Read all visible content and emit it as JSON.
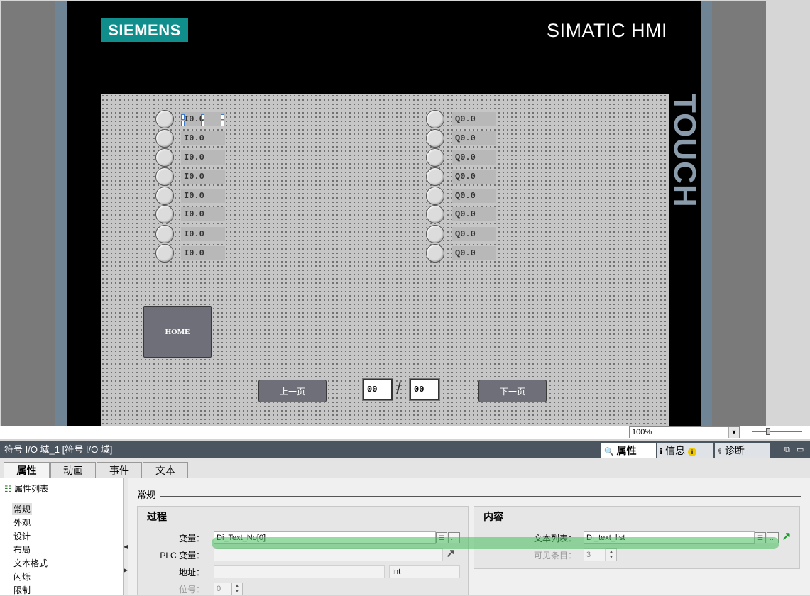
{
  "hmi": {
    "brand": "SIEMENS",
    "title": "SIMATIC HMI",
    "touch_label": "TOUCH",
    "inputs": [
      "I0.0",
      "I0.0",
      "I0.0",
      "I0.0",
      "I0.0",
      "I0.0",
      "I0.0",
      "I0.0"
    ],
    "outputs": [
      "Q0.0",
      "Q0.0",
      "Q0.0",
      "Q0.0",
      "Q0.0",
      "Q0.0",
      "Q0.0",
      "Q0.0"
    ],
    "home_label": "HOME",
    "prev_label": "上一页",
    "next_label": "下一页",
    "page_current": "00",
    "page_total": "00",
    "slash": "/"
  },
  "zoom": {
    "value": "100%"
  },
  "inspector": {
    "title": "符号 I/O 域_1 [符号 I/O 域]",
    "panel_tabs": [
      "属性",
      "信息",
      "诊断"
    ],
    "tabs": [
      "属性",
      "动画",
      "事件",
      "文本"
    ],
    "property_list_label": "属性列表",
    "property_items": [
      "常规",
      "外观",
      "设计",
      "布局",
      "文本格式",
      "闪烁",
      "限制"
    ],
    "section": "常规",
    "process": {
      "title": "过程",
      "variable_label": "变量：",
      "variable_value": "Di_Text_No[0]",
      "plc_variable_label": "PLC 变量：",
      "address_label": "地址：",
      "address_type": "Int",
      "bit_label": "位号：",
      "bit_value": "0"
    },
    "content": {
      "title": "内容",
      "text_list_label": "文本列表：",
      "text_list_value": "DI_text_list",
      "visible_items_label": "可见条目：",
      "visible_items_value": "3"
    }
  }
}
